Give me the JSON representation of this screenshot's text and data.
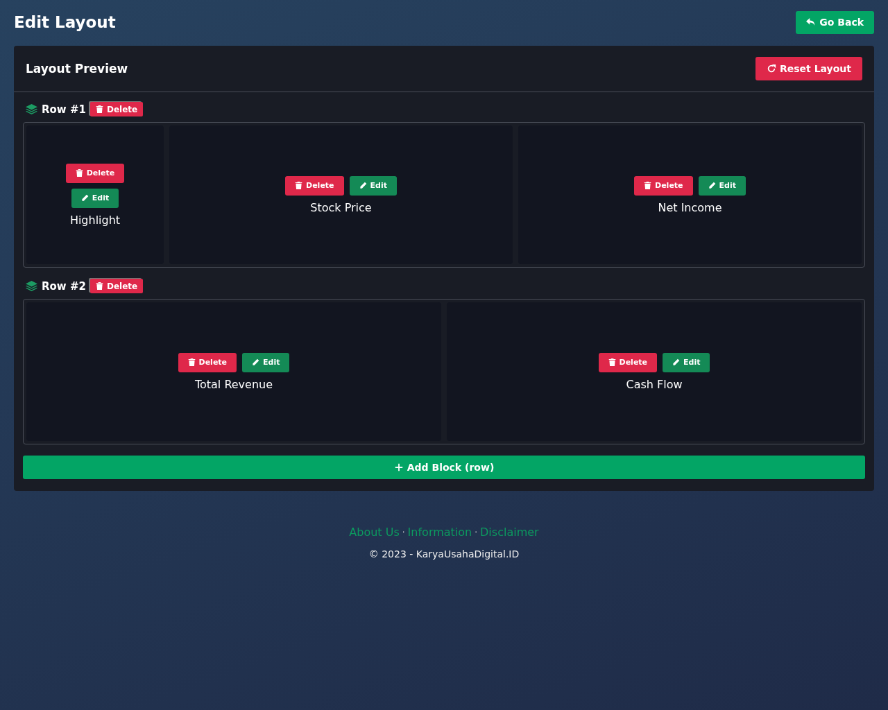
{
  "header": {
    "title": "Edit Layout",
    "back_button": "Go Back"
  },
  "panel": {
    "title": "Layout Preview",
    "reset_button": "Reset Layout",
    "rows": [
      {
        "label": "Row #1",
        "delete_button": "Delete",
        "blocks": [
          {
            "kind": "compact",
            "title": "Highlight",
            "delete_button": "Delete",
            "edit_button": "Edit"
          },
          {
            "kind": "wide",
            "title": "Stock Price",
            "delete_button": "Delete",
            "edit_button": "Edit"
          },
          {
            "kind": "wide",
            "title": "Net Income",
            "delete_button": "Delete",
            "edit_button": "Edit"
          }
        ]
      },
      {
        "label": "Row #2",
        "delete_button": "Delete",
        "blocks": [
          {
            "kind": "wide",
            "title": "Total Revenue",
            "delete_button": "Delete",
            "edit_button": "Edit"
          },
          {
            "kind": "wide",
            "title": "Cash Flow",
            "delete_button": "Delete",
            "edit_button": "Edit"
          }
        ]
      }
    ],
    "add_button": "Add Block (row)"
  },
  "footer": {
    "links": [
      "About Us",
      "Information",
      "Disclaimer"
    ],
    "separators": [
      "·",
      "·"
    ],
    "copyright": "© 2023 - KaryaUsahaDigital.ID"
  }
}
